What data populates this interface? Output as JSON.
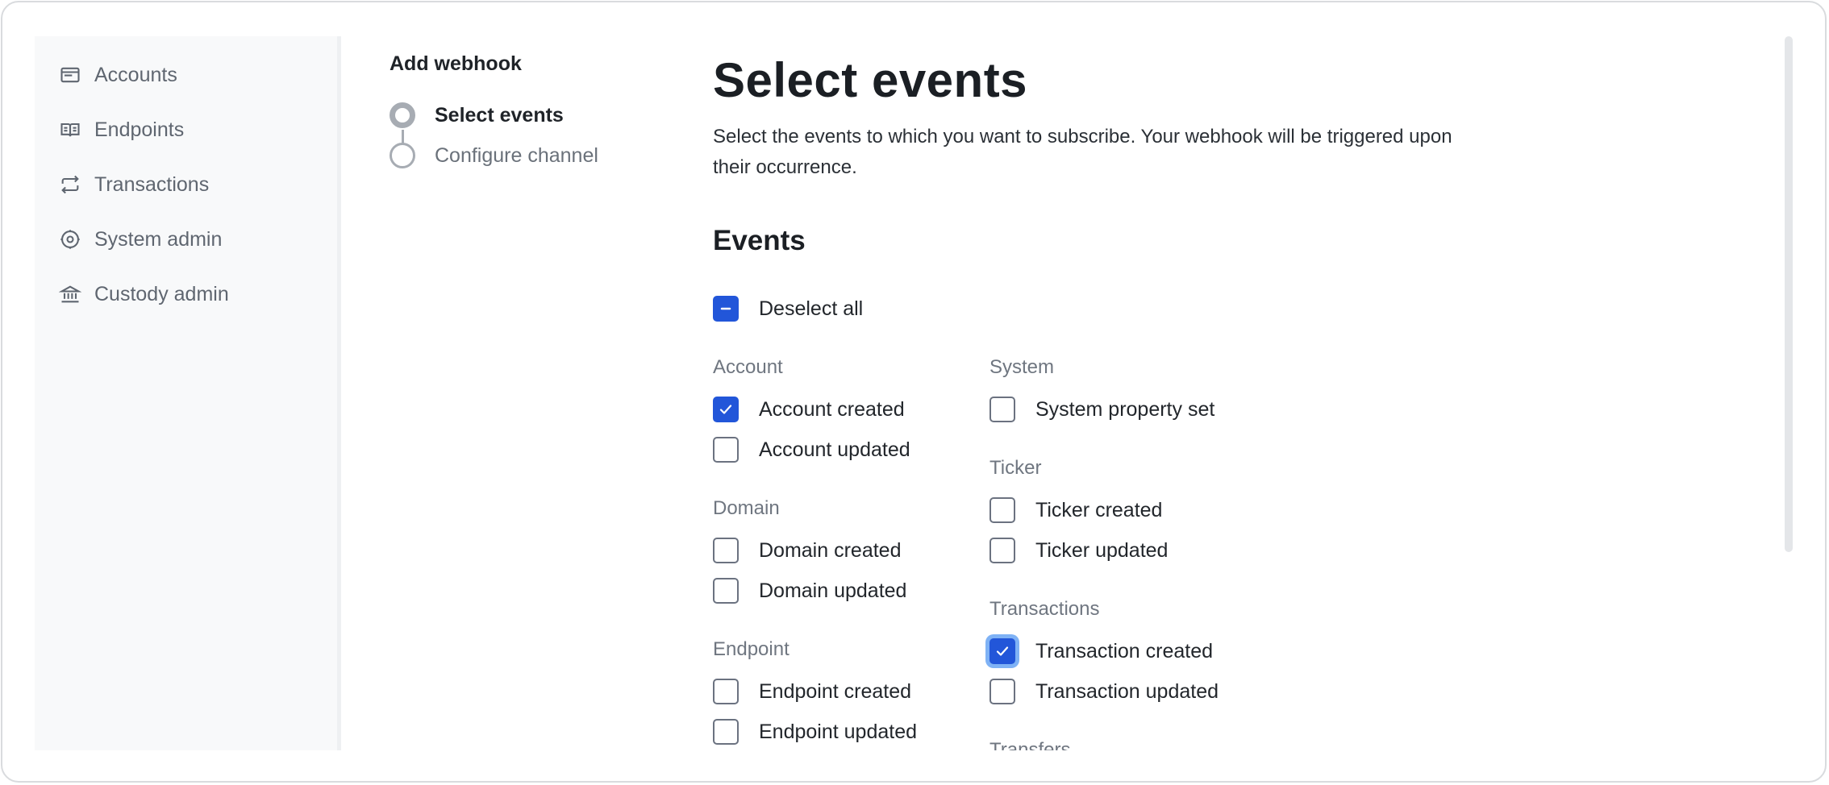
{
  "sidebar": {
    "items": [
      {
        "label": "Accounts",
        "icon": "accounts-card-icon"
      },
      {
        "label": "Endpoints",
        "icon": "book-icon"
      },
      {
        "label": "Transactions",
        "icon": "arrows-swap-icon"
      },
      {
        "label": "System admin",
        "icon": "gear-icon"
      },
      {
        "label": "Custody admin",
        "icon": "bank-icon"
      }
    ]
  },
  "stepper": {
    "title": "Add webhook",
    "steps": [
      {
        "label": "Select events",
        "state": "active"
      },
      {
        "label": "Configure channel",
        "state": "pending"
      }
    ]
  },
  "main": {
    "title": "Select events",
    "description": "Select the events to which you want to subscribe. Your webhook will be triggered upon their occurrence.",
    "events_heading": "Events",
    "deselect_all": {
      "label": "Deselect all",
      "state": "indeterminate"
    }
  },
  "groups": {
    "account": {
      "label": "Account",
      "items": [
        {
          "label": "Account created",
          "checked": true
        },
        {
          "label": "Account updated",
          "checked": false
        }
      ]
    },
    "domain": {
      "label": "Domain",
      "items": [
        {
          "label": "Domain created",
          "checked": false
        },
        {
          "label": "Domain updated",
          "checked": false
        }
      ]
    },
    "endpoint": {
      "label": "Endpoint",
      "items": [
        {
          "label": "Endpoint created",
          "checked": false
        },
        {
          "label": "Endpoint updated",
          "checked": false
        }
      ]
    },
    "system": {
      "label": "System",
      "items": [
        {
          "label": "System property set",
          "checked": false
        }
      ]
    },
    "ticker": {
      "label": "Ticker",
      "items": [
        {
          "label": "Ticker created",
          "checked": false
        },
        {
          "label": "Ticker updated",
          "checked": false
        }
      ]
    },
    "transactions": {
      "label": "Transactions",
      "items": [
        {
          "label": "Transaction created",
          "checked": true,
          "focused": true
        },
        {
          "label": "Transaction updated",
          "checked": false
        }
      ]
    },
    "transfers": {
      "label": "Transfers"
    }
  },
  "colors": {
    "accent": "#2256d9",
    "focus_ring": "#7fb2f5",
    "sidebar_bg": "#f8f9fa",
    "muted_text": "#6f7680"
  }
}
